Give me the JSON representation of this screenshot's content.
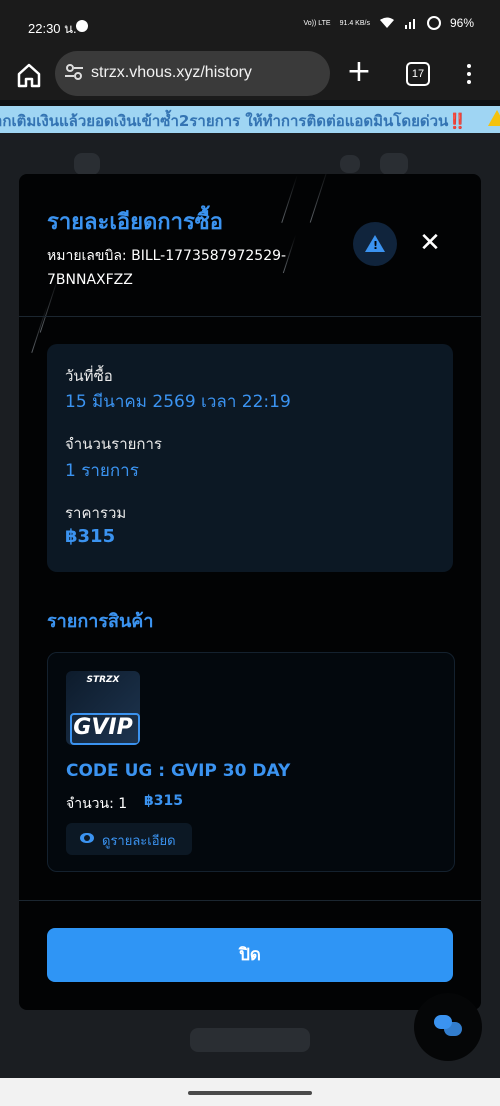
{
  "status_bar": {
    "time": "22:30 น.",
    "network_label": "Vo)) LTE",
    "speed": "91.4 KB/s",
    "battery": "96%"
  },
  "browser": {
    "url": "strzx.vhous.xyz/history",
    "tab_count": "17"
  },
  "marquee": {
    "text": "ากเติมเงินแล้วยอดเงินเข้าซ้ำ2รายการ ให้ทำการติดต่อแอดมินโดยด่วน‼️"
  },
  "modal": {
    "title": "รายละเอียดการซื้อ",
    "bill_line1": "หมายเลขบิล: BILL-1773587972529-",
    "bill_line2": "7BNNAXFZZ",
    "close_symbol": "✕",
    "info": {
      "purchase_date_label": "วันที่ซื้อ",
      "purchase_date_value": "15 มีนาคม 2569 เวลา 22:19",
      "item_count_label": "จำนวนรายการ",
      "item_count_value": "1 รายการ",
      "total_label": "ราคารวม",
      "total_value": "฿315"
    },
    "items_section_title": "รายการสินค้า",
    "item": {
      "thumb_brand": "STRZX",
      "thumb_label": "GVIP",
      "name": "CODE UG : GVIP 30 DAY",
      "quantity": "จำนวน: 1",
      "price": "฿315",
      "detail_button": "ดูรายละเอียด"
    },
    "close_button": "ปิด"
  },
  "colors": {
    "accent": "#3b93f0",
    "button": "#2f95f5",
    "modal_bg": "#020304",
    "marquee_bg": "#9fd5f3"
  },
  "icons": [
    "home-icon",
    "tune-icon",
    "plus-icon",
    "tabs-icon",
    "menu-dots-icon",
    "warning-icon",
    "close-icon",
    "eye-icon",
    "chat-icon"
  ]
}
